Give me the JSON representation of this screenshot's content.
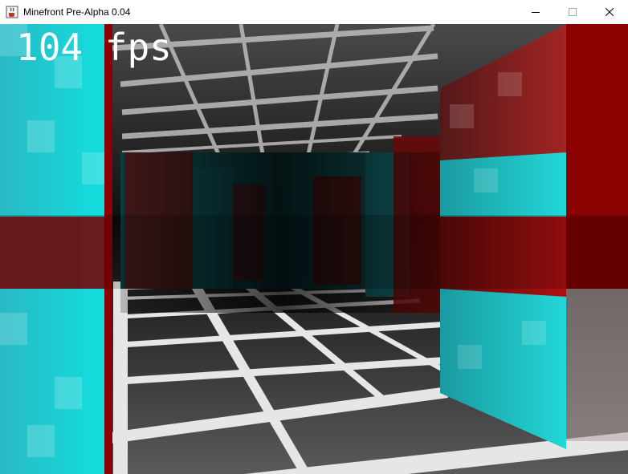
{
  "window": {
    "title": "Minefront Pre-Alpha 0.04",
    "icons": {
      "app": "java-cup-icon",
      "minimize": "minimize-icon",
      "maximize": "maximize-icon",
      "close": "close-icon"
    }
  },
  "hud": {
    "fps_text": "104 fps"
  },
  "scene": {
    "colors": {
      "ceiling_tile": "#3a3a3a",
      "floor_tile": "#4a4a4a",
      "grid_line": "#d8d8d8",
      "wall_cyan": "#1fd6d6",
      "wall_red": "#8a0000",
      "shadow": "#000000"
    }
  }
}
